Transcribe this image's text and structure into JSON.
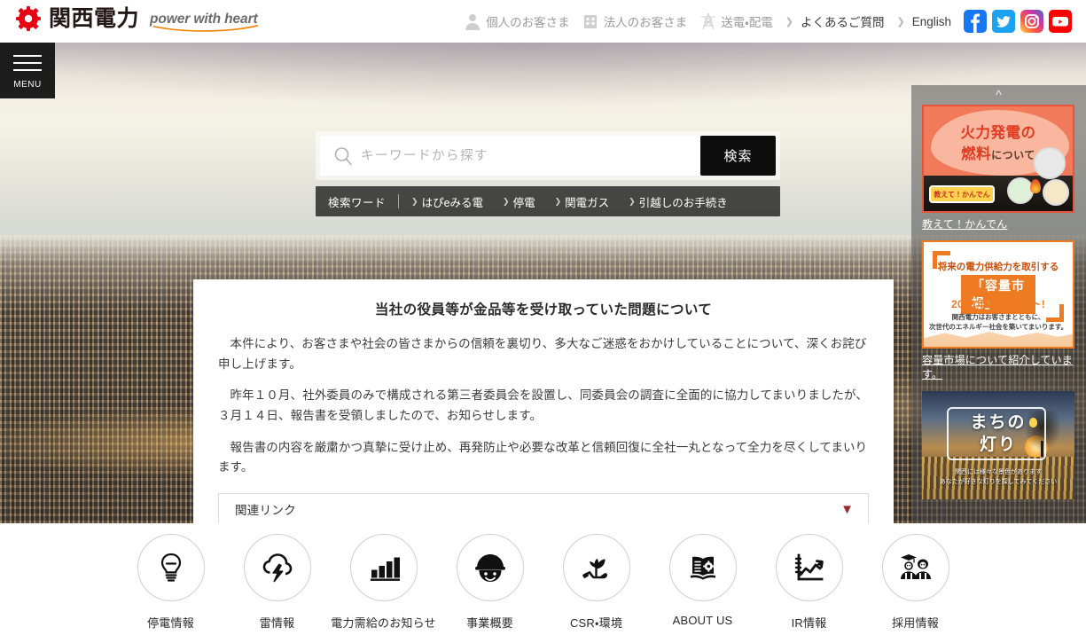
{
  "brand": {
    "name": "関西電力",
    "tagline": "power with heart",
    "logo_color": "#e60012",
    "tagline_color": "#6b6b6b",
    "swoosh_color": "#f08200"
  },
  "header": {
    "nav": [
      {
        "icon": "person-icon",
        "label": "個人のお客さま",
        "style": "muted"
      },
      {
        "icon": "building-icon",
        "label": "法人のお客さま",
        "style": "muted"
      },
      {
        "icon": "pylon-icon",
        "label": "送電・配電",
        "style": "muted"
      }
    ],
    "links": [
      {
        "icon": "chevron-right-icon",
        "label": "よくあるご質問"
      },
      {
        "icon": "chevron-right-icon",
        "label": "English"
      }
    ],
    "social": [
      {
        "name": "facebook-icon",
        "color": "#1877f2"
      },
      {
        "name": "twitter-icon",
        "color": "#1da1f2"
      },
      {
        "name": "instagram-icon",
        "color": "#e1306c"
      },
      {
        "name": "youtube-icon",
        "color": "#ff0000"
      }
    ]
  },
  "menu_button": {
    "label": "MENU",
    "icon": "hamburger-icon"
  },
  "search": {
    "icon": "search-icon",
    "placeholder": "キーワードから探す",
    "value": "",
    "button_label": "検索",
    "keywords_label": "検索ワード",
    "keywords": [
      "はぴeみる電",
      "停電",
      "関電ガス",
      "引越しのお手続き"
    ]
  },
  "notice": {
    "title": "当社の役員等が金品等を受け取っていた問題について",
    "paragraphs": [
      "本件により、お客さまや社会の皆さまからの信頼を裏切り、多大なご迷惑をおかけしていることについて、深くお詫び申し上げます。",
      "昨年１０月、社外委員のみで構成される第三者委員会を設置し、同委員会の調査に全面的に協力してまいりましたが、３月１４日、報告書を受領しましたので、お知らせします。",
      "報告書の内容を厳粛かつ真摯に受け止め、再発防止や必要な改革と信頼回復に全社一丸となって全力を尽くしてまいります。"
    ],
    "accordion": {
      "label": "関連リンク",
      "icon": "chevron-down-icon",
      "icon_color": "#9e2b2b",
      "expanded": false
    }
  },
  "sidebar": {
    "scroll_up_icon": "chevron-up-icon",
    "scroll_down_icon": "chevron-down-icon",
    "banners": [
      {
        "id": "kanden-thermal-fuel",
        "title_line1": "火力発電の",
        "title_line2_strong": "燃料",
        "title_line2_rest": "について",
        "badge": "教えて！かんでん",
        "caption": "教えて！かんでん",
        "accent": "#e8543a"
      },
      {
        "id": "capacity-market",
        "line1": "将来の電力供給力を取引する",
        "line2": "「容量市場」",
        "line3": "2020年にスタート!",
        "line4a": "関西電力はお客さまとともに、",
        "line4b": "次世代のエネルギー社会を築いてまいります。",
        "caption": "容量市場について紹介しています。",
        "accent": "#ee7a22"
      },
      {
        "id": "machi-no-akari",
        "word1": "まちの",
        "word2": "灯り",
        "cap1": "関西には様々な景色があります",
        "cap2": "あなたが好きな灯りを探してみてください",
        "caption": "",
        "accent": "#ffd24d"
      }
    ]
  },
  "icon_nav": [
    {
      "icon": "lightbulb-outage-icon",
      "label": "停電情報"
    },
    {
      "icon": "thunder-cloud-icon",
      "label": "雷情報"
    },
    {
      "icon": "bar-chart-icon",
      "label": "電力需給のお知らせ"
    },
    {
      "icon": "worker-face-icon",
      "label": "事業概要"
    },
    {
      "icon": "plant-hand-icon",
      "label": "CSR・環境"
    },
    {
      "icon": "open-book-icon",
      "label": "ABOUT US"
    },
    {
      "icon": "line-chart-icon",
      "label": "IR情報"
    },
    {
      "icon": "graduates-icon",
      "label": "採用情報"
    }
  ]
}
